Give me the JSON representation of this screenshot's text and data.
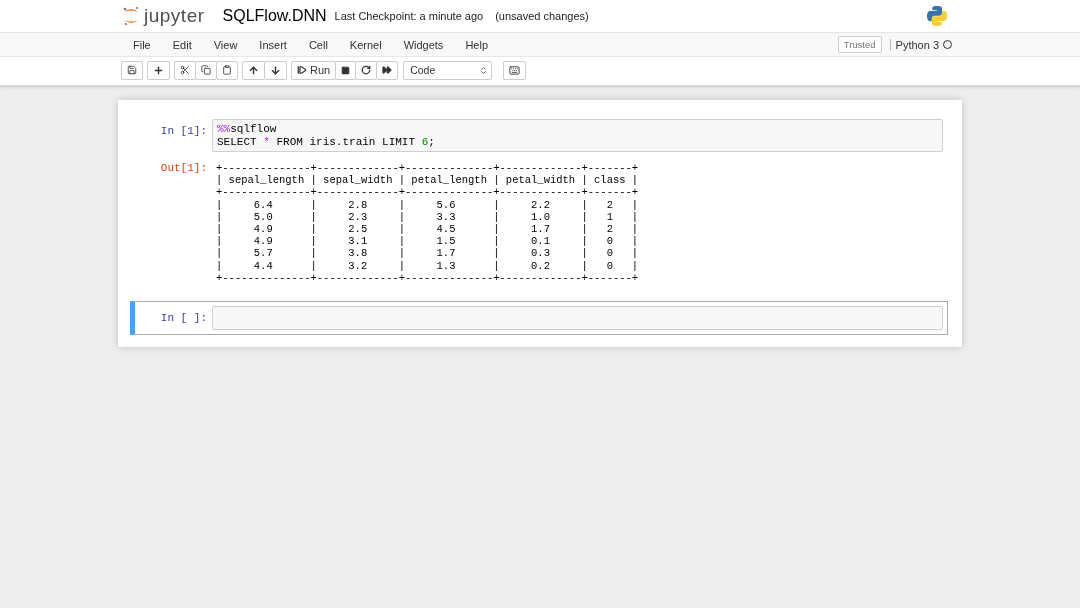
{
  "header": {
    "logo_text": "jupyter",
    "notebook_name": "SQLFlow.DNN",
    "checkpoint": "Last Checkpoint: a minute ago",
    "save_status": "(unsaved changes)"
  },
  "menu": [
    "File",
    "Edit",
    "View",
    "Insert",
    "Cell",
    "Kernel",
    "Widgets",
    "Help"
  ],
  "trusted": "Trusted",
  "kernel_name": "Python 3",
  "toolbar": {
    "run_label": "Run",
    "cell_type": "Code"
  },
  "cells": [
    {
      "prompt": "In [1]:",
      "selected": false,
      "input_lines": [
        [
          {
            "text": "%%",
            "kind": "magic"
          },
          {
            "text": "sqlflow",
            "kind": "plain"
          }
        ],
        [
          {
            "text": "SELECT ",
            "kind": "plain"
          },
          {
            "text": "*",
            "kind": "operator"
          },
          {
            "text": " FROM iris.train LIMIT ",
            "kind": "plain"
          },
          {
            "text": "6",
            "kind": "number"
          },
          {
            "text": ";",
            "kind": "plain"
          }
        ]
      ],
      "output_prompt": "Out[1]:",
      "output_lines": [
        "+--------------+-------------+--------------+-------------+-------+",
        "| sepal_length | sepal_width | petal_length | petal_width | class |",
        "+--------------+-------------+--------------+-------------+-------+",
        "|     6.4      |     2.8     |     5.6      |     2.2     |   2   |",
        "|     5.0      |     2.3     |     3.3      |     1.0     |   1   |",
        "|     4.9      |     2.5     |     4.5      |     1.7     |   2   |",
        "|     4.9      |     3.1     |     1.5      |     0.1     |   0   |",
        "|     5.7      |     3.8     |     1.7      |     0.3     |   0   |",
        "|     4.4      |     3.2     |     1.3      |     0.2     |   0   |",
        "+--------------+-------------+--------------+-------------+-------+"
      ]
    },
    {
      "prompt": "In [ ]:",
      "selected": true
    }
  ]
}
